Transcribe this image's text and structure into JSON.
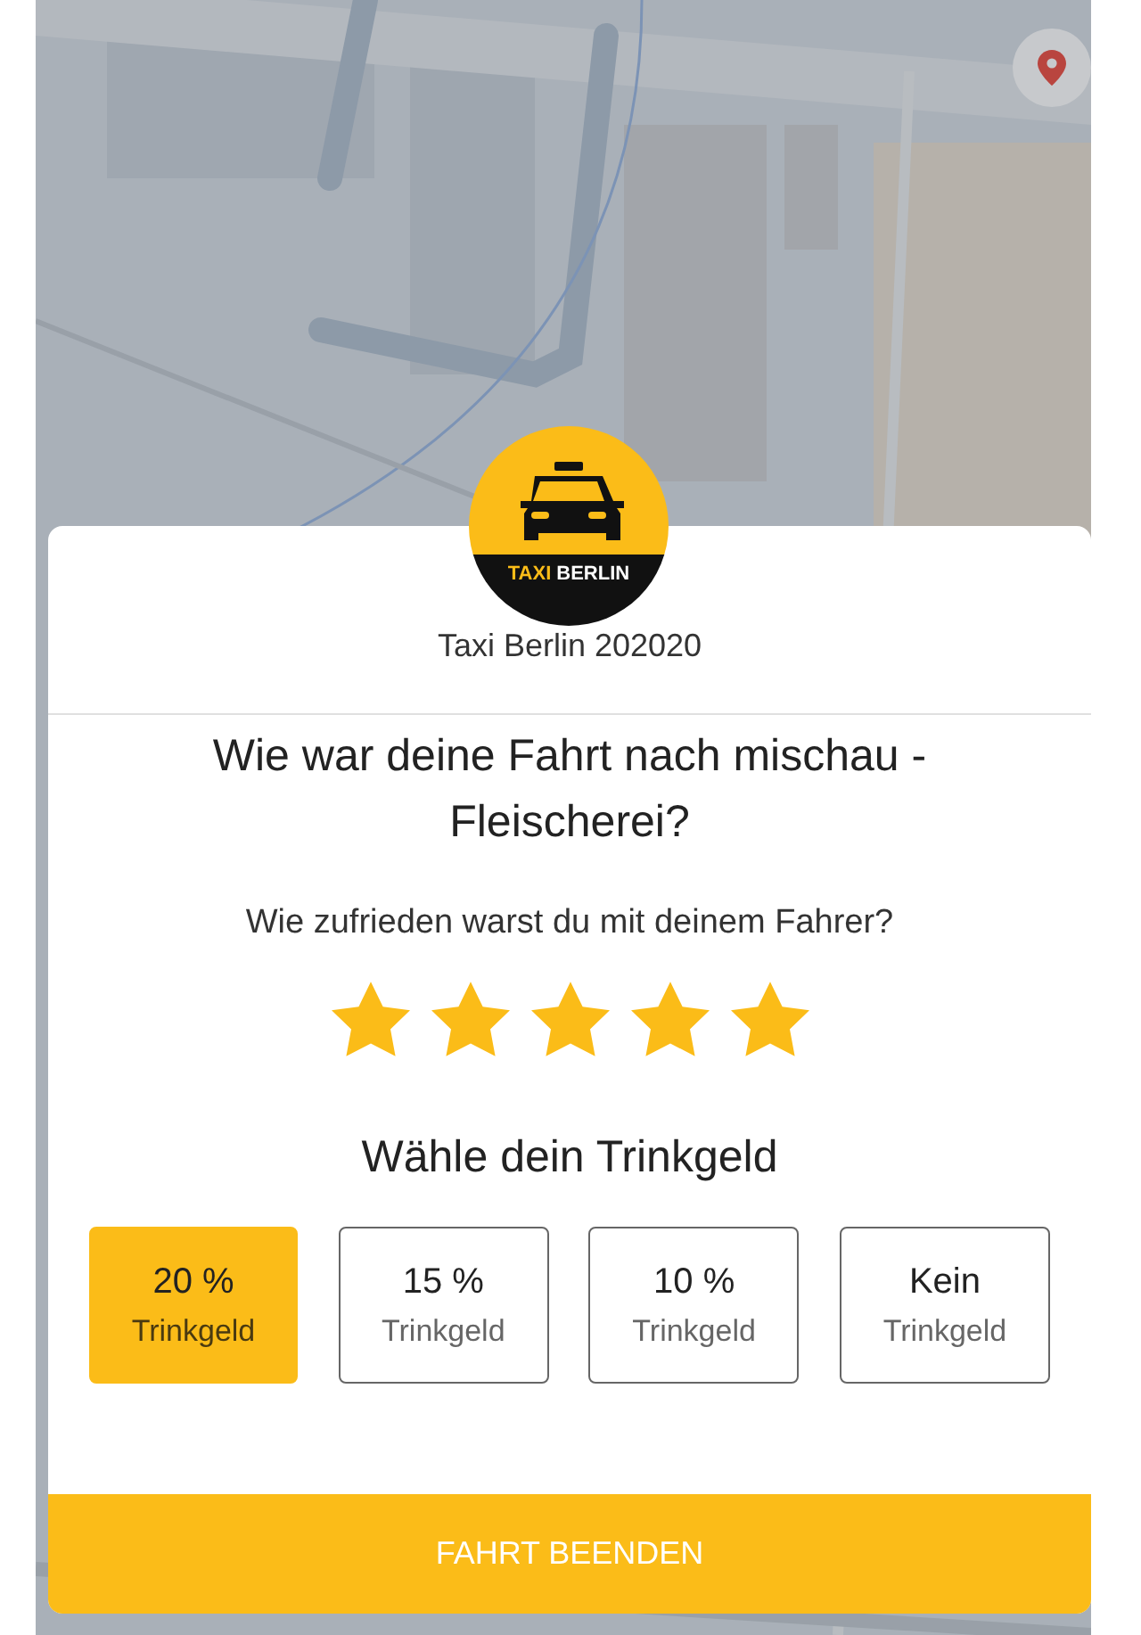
{
  "location_button": {
    "kind": "pin"
  },
  "logo": {
    "text_primary": "TAXI",
    "text_secondary": "BERLIN"
  },
  "company": "Taxi Berlin 202020",
  "title": "Wie war deine Fahrt nach mischau - Fleischerei?",
  "question": "Wie zufrieden warst du mit deinem Fahrer?",
  "rating": {
    "stars": 5
  },
  "tip_heading": "Wähle dein Trinkgeld",
  "tips": [
    {
      "amount": "20 %",
      "label": "Trinkgeld",
      "selected": true
    },
    {
      "amount": "15 %",
      "label": "Trinkgeld",
      "selected": false
    },
    {
      "amount": "10 %",
      "label": "Trinkgeld",
      "selected": false
    },
    {
      "amount": "Kein",
      "label": "Trinkgeld",
      "selected": false
    }
  ],
  "finish_button": "FAHRT BEENDEN"
}
